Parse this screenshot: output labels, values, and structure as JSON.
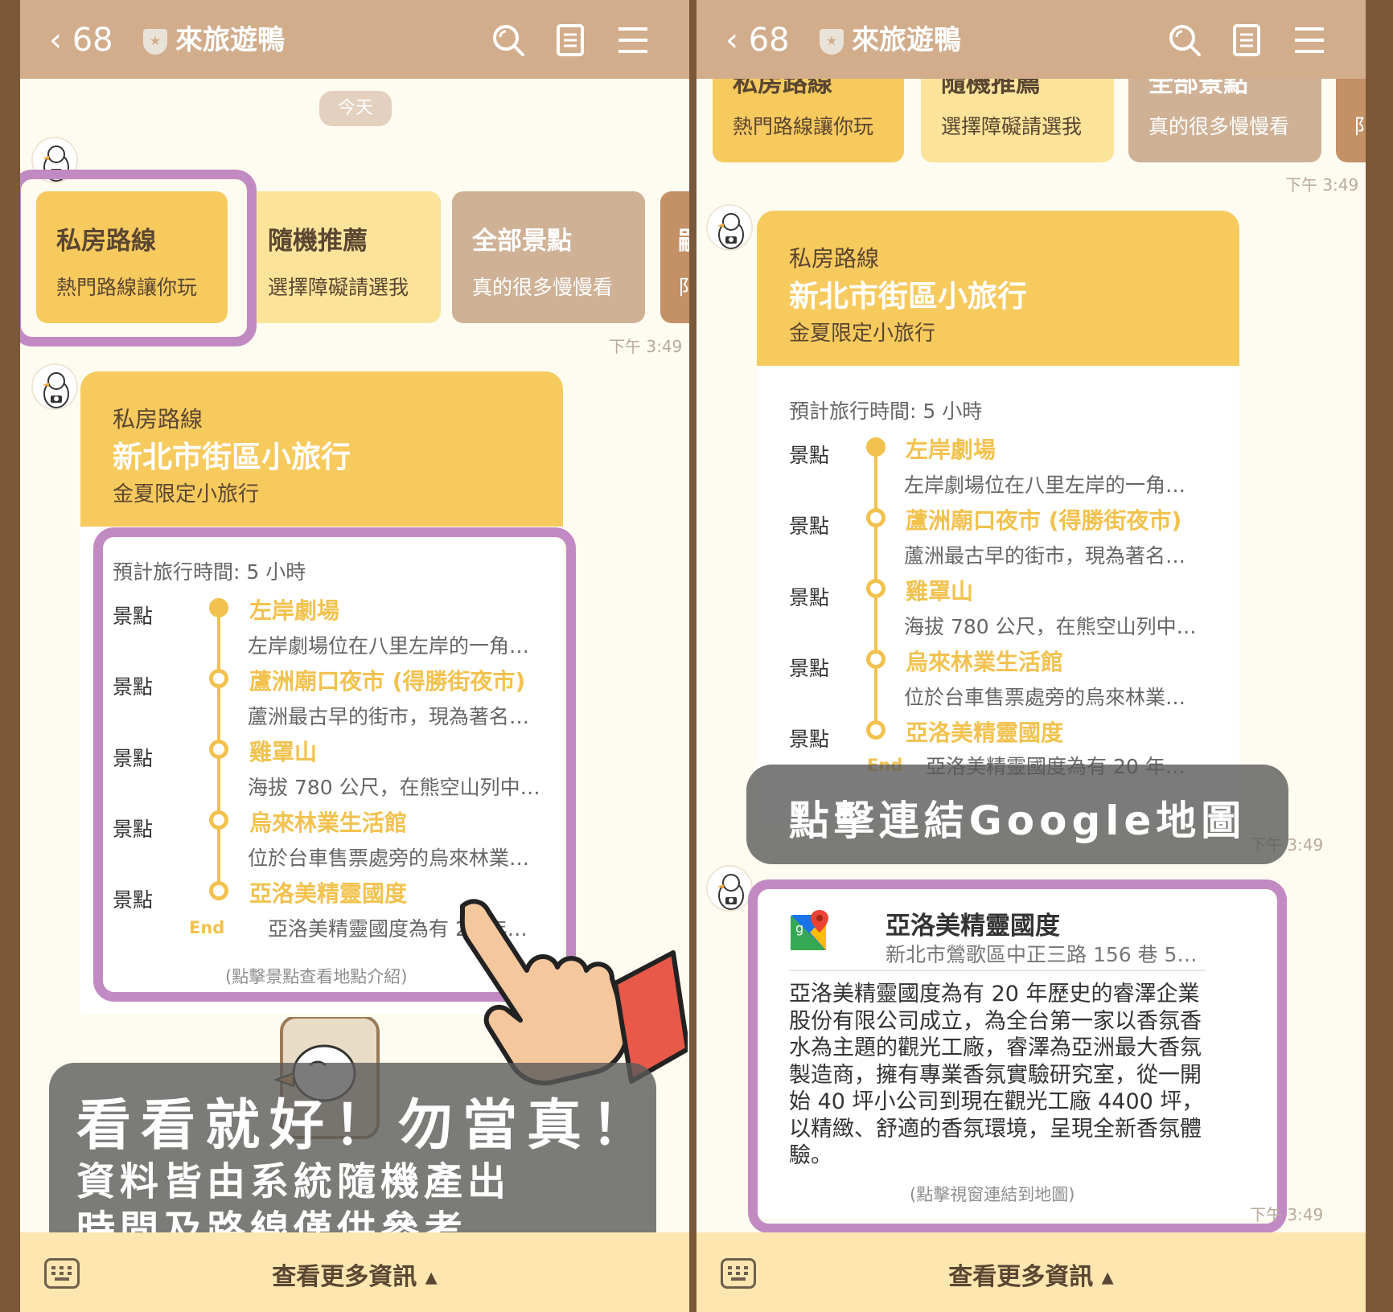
{
  "header": {
    "back_count": "68",
    "chat_title": "來旅遊鴨",
    "icons": [
      "search-icon",
      "note-icon",
      "menu-icon"
    ]
  },
  "date_label": "今天",
  "menu_cards": [
    {
      "title": "私房路線",
      "subtitle": "熱門路線讓你玩"
    },
    {
      "title": "隨機推薦",
      "subtitle": "選擇障礙請選我"
    },
    {
      "title": "全部景點",
      "subtitle": "真的很多慢慢看"
    },
    {
      "title": "嗣",
      "subtitle": "阝"
    }
  ],
  "timestamp": "下午 3:49",
  "route": {
    "category": "私房路線",
    "title": "新北市街區小旅行",
    "tag": "金夏限定小旅行",
    "duration": "預計旅行時間: 5 小時",
    "stop_label": "景點",
    "end_label": "End",
    "hint": "(點擊景點查看地點介紹)",
    "stops": [
      {
        "name": "左岸劇場",
        "desc": "左岸劇場位在八里左岸的一角…"
      },
      {
        "name": "蘆洲廟口夜市 (得勝街夜市)",
        "desc": "蘆洲最古早的街市，現為著名…"
      },
      {
        "name": "雞罩山",
        "desc": "海拔 780 公尺，在熊空山列中…"
      },
      {
        "name": "烏來林業生活館",
        "desc": "位於台車售票處旁的烏來林業…"
      },
      {
        "name": "亞洛美精靈國度",
        "desc": "亞洛美精靈國度為有 20 年…"
      }
    ]
  },
  "overlay_left": {
    "line1": "看看就好！勿當真！",
    "line2": "資料皆由系統隨機產出",
    "line3": "時間及路線僅供參考"
  },
  "overlay_right": {
    "text": "點擊連結Google地圖"
  },
  "map_card": {
    "title": "亞洛美精靈國度",
    "address": "新北市鶯歌區中正三路 156 巷 5…",
    "description": "亞洛美精靈國度為有 20 年歷史的睿澤企業股份有限公司成立，為全台第一家以香氛香水為主題的觀光工廠，睿澤為亞洲最大香氛製造商，擁有專業香氛實驗研究室，從一開始 40 坪小公司到現在觀光工廠 4400 坪，以精緻、舒適的香氛環境，呈現全新香氛體驗。",
    "hint": "(點擊視窗連結到地圖)"
  },
  "bottom_bar": {
    "more_label": "查看更多資訊 ▴"
  },
  "colors": {
    "header": "#d2ad8c",
    "accent": "#f7ca5e",
    "highlight": "#c28ac2",
    "bottom_bar": "#fde6b0"
  }
}
